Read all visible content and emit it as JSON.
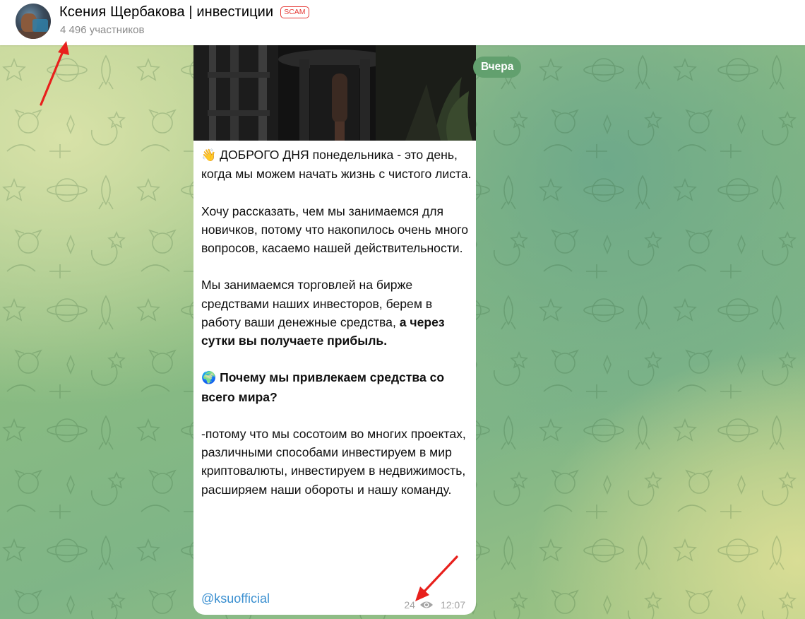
{
  "header": {
    "title": "Ксения Щербакова | инвестиции",
    "badge": "SCAM",
    "members": "4 496 участников"
  },
  "date_pill": "Вчера",
  "message": {
    "p1_emoji": "👋",
    "p1_bold": "ДОБРОГО ДНЯ",
    "p1_rest": " понедельника - это день, когда мы можем начать жизнь с чистого листа.",
    "p2": "Хочу рассказать, чем мы занимаемся для новичков, потому что накопилось очень много вопросов, касаемо нашей действительности.",
    "p3_rest": "Мы занимаемся торговлей на бирже средствами наших инвесторов, берем в работу ваши денежные средства, ",
    "p3_bold": "а через сутки вы получаете прибыль.",
    "p4_emoji": "🌍",
    "p4_bold": "Почему мы привлекаем средства со всего мира?",
    "p5": "-потому что мы сосотоим во многих проектах, различными способами инвестируем в мир криптовалюты, инвестируем в недвижимость, расширяем наши обороты и нашу команду.",
    "mention": "@ksuofficial",
    "views": "24",
    "time": "12:07"
  },
  "annotation_color": "#e8201c",
  "icons": {
    "views": "eye-icon"
  }
}
